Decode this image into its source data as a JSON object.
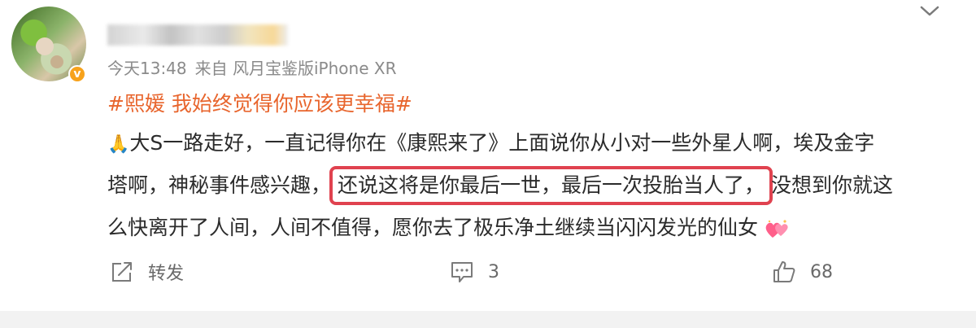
{
  "post": {
    "meta": {
      "time": "今天13:48",
      "source": "来自 风月宝鉴版iPhone XR"
    },
    "topic": "#熙媛 我始终觉得你应该更幸福#",
    "content": {
      "line1_emoji": "🙏",
      "line1": "大S一路走好，一直记得你在《康熙来了》上面说你从小对一些外星人啊，埃及金字",
      "line2_before": "塔啊，神秘事件感兴趣，",
      "line2_highlight": "还说这将是你最后一世，最后一次投胎当人了，",
      "line2_after": "没想到你就这",
      "line3": "么快离开了人间，人间不值得，愿你去了极乐净土继续当闪闪发光的仙女"
    },
    "actions": {
      "repost_label": "转发",
      "comment_count": "3",
      "like_count": "68"
    }
  },
  "colors": {
    "topic": "#e8652d",
    "highlight_border": "#e0424f",
    "verified": "#f7a21b",
    "meta": "#8a8a8a"
  },
  "icons": [
    "verified-badge-icon",
    "chevron-down-icon",
    "repost-icon",
    "comment-icon",
    "like-icon",
    "hearts-emoji-icon"
  ]
}
